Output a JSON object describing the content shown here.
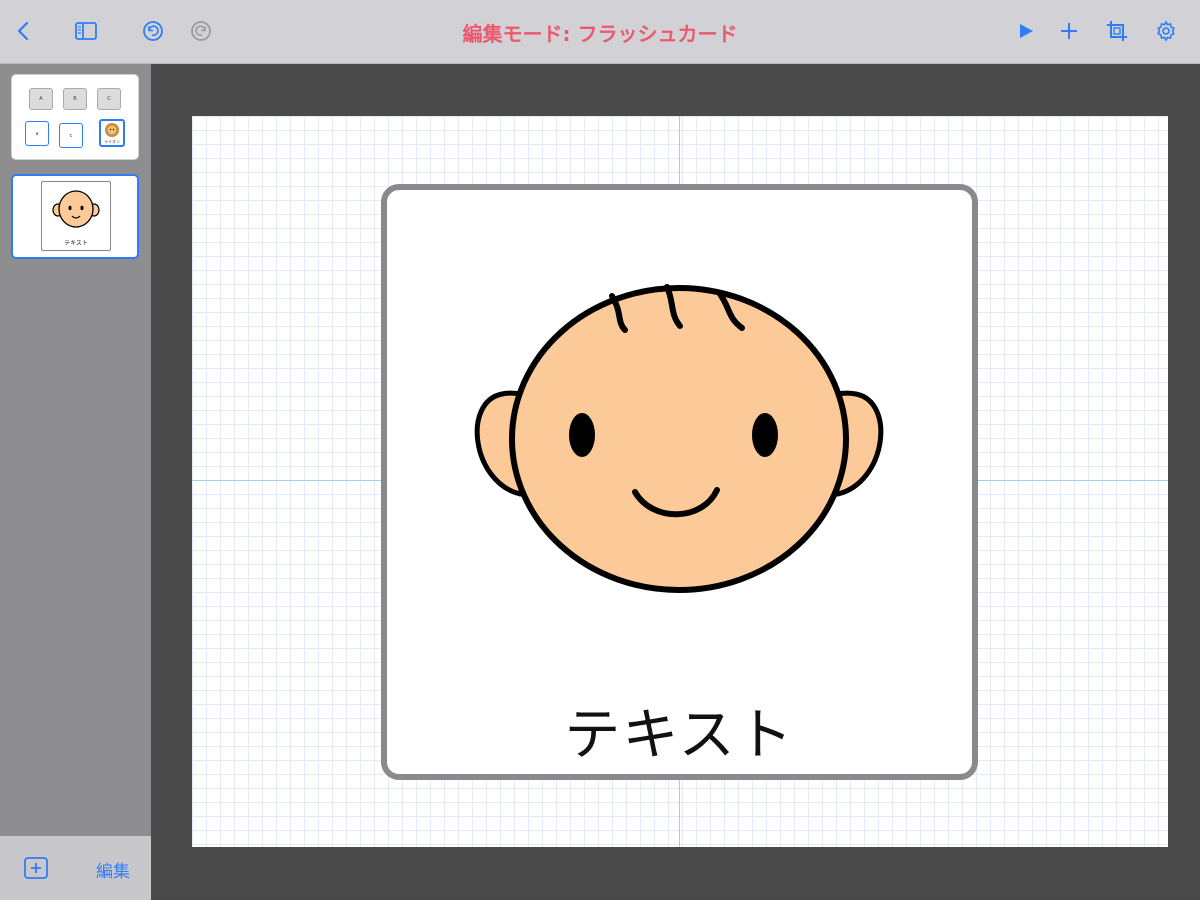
{
  "toolbar": {
    "title": "編集モード: フラッシュカード",
    "title_color": "#ea5a6e",
    "accent_color": "#2f7df6",
    "left_icons": [
      "back-icon",
      "sidebar-toggle-icon",
      "undo-icon",
      "redo-icon"
    ],
    "right_icons": [
      "play-icon",
      "add-icon",
      "crop-icon",
      "settings-icon"
    ]
  },
  "sidebar": {
    "pages": [
      {
        "keys": [
          "A",
          "B",
          "C"
        ],
        "boxes": [
          "a",
          "c"
        ],
        "image_label": "ライオン"
      },
      {
        "label": "テキスト",
        "selected": true
      }
    ],
    "edit_label": "編集"
  },
  "card": {
    "label": "テキスト",
    "face_color": "#fcca98"
  }
}
